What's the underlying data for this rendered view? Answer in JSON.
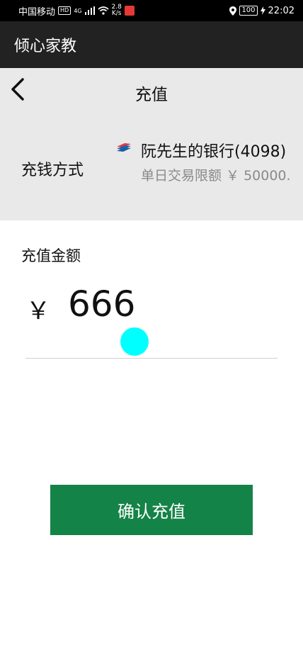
{
  "status_bar": {
    "carrier": "中国移动",
    "hd_badge": "HD",
    "network": "4G",
    "speed_value": "2.8",
    "speed_unit": "K/s",
    "battery": "100",
    "time": "22:02"
  },
  "app_bar": {
    "title": "倾心家教"
  },
  "nav": {
    "title": "充值"
  },
  "payment": {
    "label": "充钱方式",
    "bank_name": "阮先生的银行(4098)",
    "limit_text": "单日交易限额 ￥ 50000."
  },
  "amount": {
    "label": "充值金额",
    "currency": "￥",
    "value": "666"
  },
  "confirm_button": {
    "label": "确认充值"
  },
  "colors": {
    "status_bar_bg": "#000000",
    "app_bar_bg": "#222222",
    "section_bg": "#e9e9e9",
    "button_bg": "#148347",
    "touch_indicator": "#00ffff"
  }
}
